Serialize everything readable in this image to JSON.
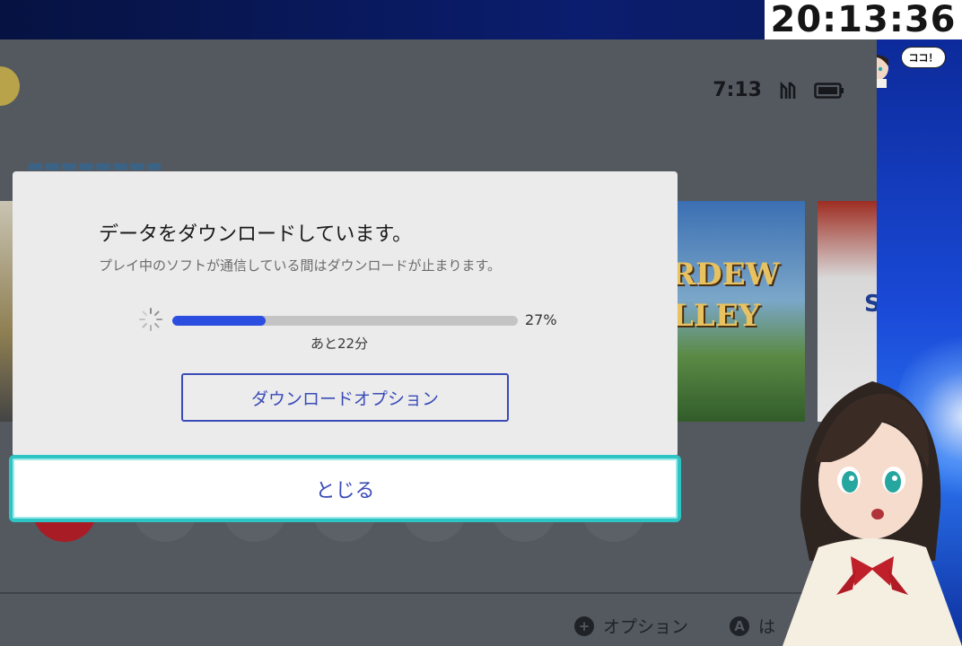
{
  "stream": {
    "clock": "20:13:36",
    "mascot_speech": "ココ！"
  },
  "console": {
    "time": "7:13",
    "footer": {
      "options_label": "オプション",
      "a_label": "は"
    },
    "tiles": {
      "stardew_line1": "RDEW",
      "stardew_line2": "LLEY",
      "third_letter": "S"
    }
  },
  "dialog": {
    "title": "データをダウンロードしています。",
    "subtitle": "プレイ中のソフトが通信している間はダウンロードが止まります。",
    "progress_percent": 27,
    "progress_label": "27%",
    "remaining": "あと22分",
    "options_button": "ダウンロードオプション",
    "close_button": "とじる"
  },
  "colors": {
    "accent": "#3a4bb7",
    "progress_fill": "#2b4ee0",
    "focus_ring": "#2ec4c4"
  }
}
